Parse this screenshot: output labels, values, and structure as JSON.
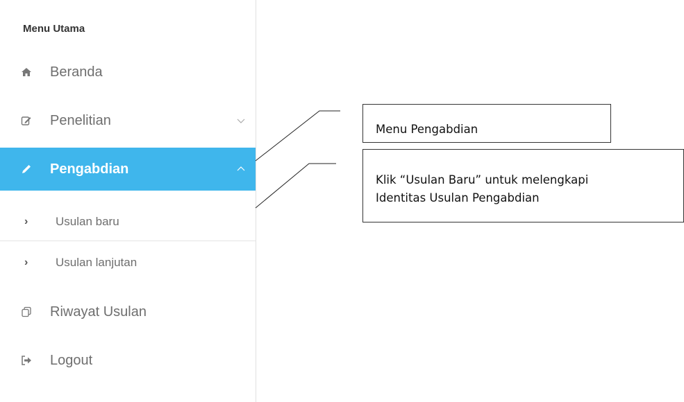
{
  "sidebar": {
    "header": "Menu Utama",
    "items": {
      "beranda": "Beranda",
      "penelitian": "Penelitian",
      "pengabdian": "Pengabdian",
      "usulan_baru": "Usulan baru",
      "usulan_lanjutan": "Usulan lanjutan",
      "riwayat": "Riwayat Usulan",
      "logout": "Logout"
    },
    "icons": {
      "beranda": "home-icon",
      "penelitian": "edit-icon",
      "pengabdian": "pencil-icon",
      "riwayat": "copy-icon",
      "logout": "sign-out-icon"
    }
  },
  "callouts": {
    "menu_pengabdian": "Menu Pengabdian",
    "line1": "Klik “Usulan Baru” untuk melengkapi",
    "line2": "Identitas Usulan Pengabdian"
  },
  "colors": {
    "active_background": "#3fb6ec",
    "text": "#6e6e6e"
  }
}
